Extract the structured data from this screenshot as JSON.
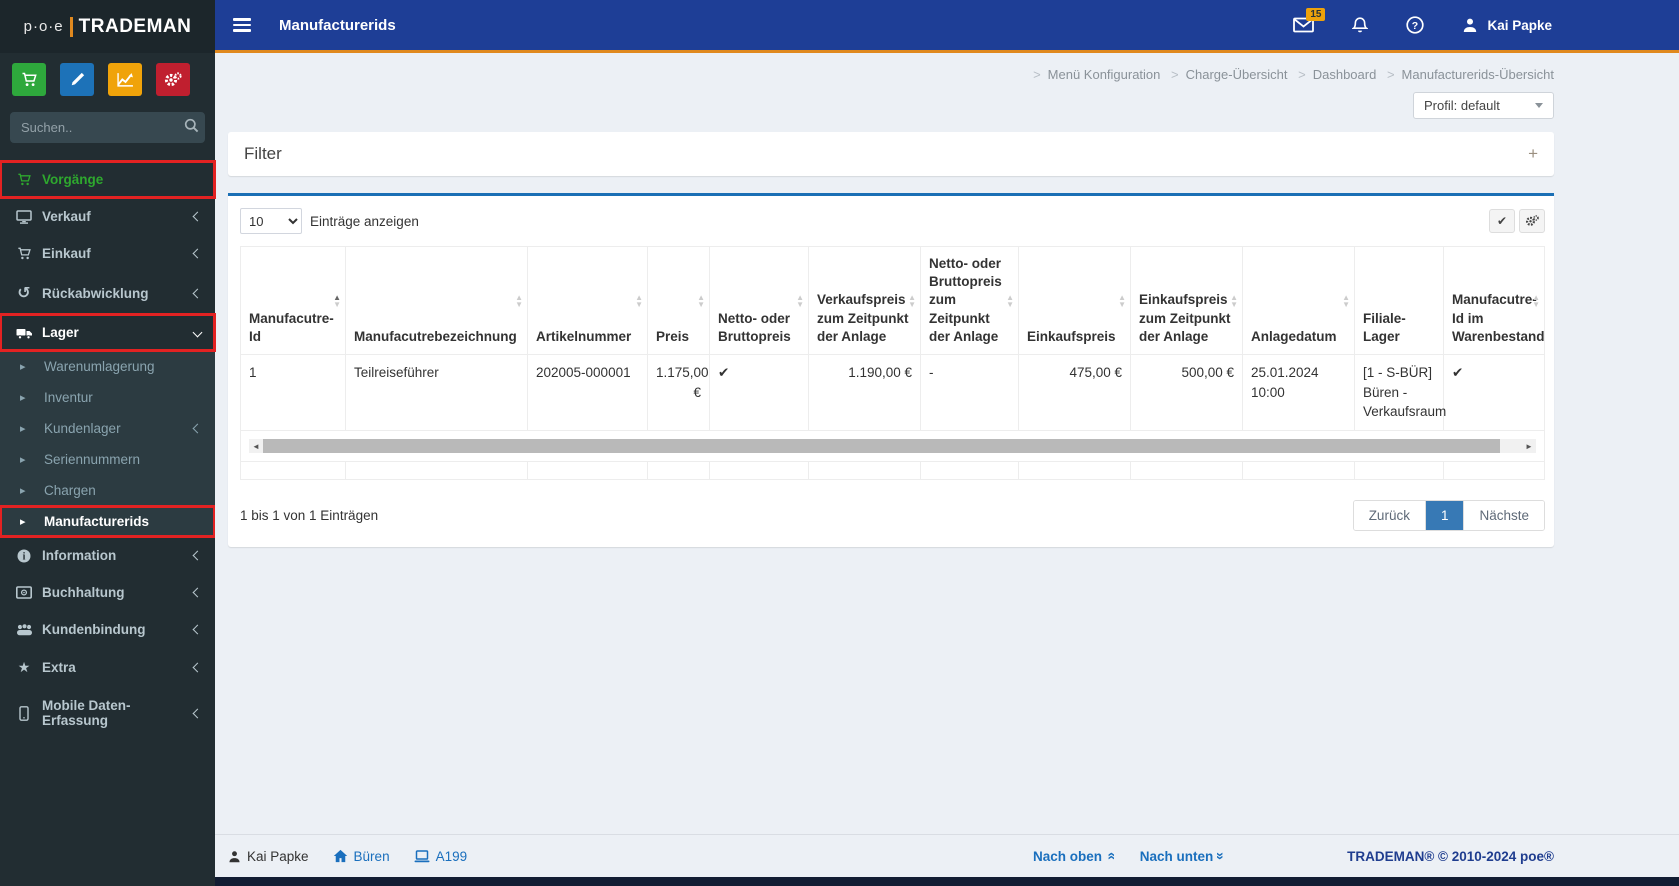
{
  "app": {
    "brand_prefix": "p·o·e",
    "brand": "TRADEMAN"
  },
  "header": {
    "title": "Manufacturerids",
    "mail_badge": "15",
    "user": "Kai Papke"
  },
  "sidebar": {
    "search_placeholder": "Suchen..",
    "quick_buttons": [
      {
        "icon": "cart-icon",
        "color": "#2ea83c"
      },
      {
        "icon": "pencil-icon",
        "color": "#1d72b8"
      },
      {
        "icon": "chart-line-icon",
        "color": "#f0a30a"
      },
      {
        "icon": "gears-icon",
        "color": "#c01f2f"
      }
    ],
    "items": [
      {
        "label": "Vorgänge",
        "icon": "cart-icon",
        "highlighted": true
      },
      {
        "label": "Verkauf",
        "icon": "monitor-icon",
        "has_children": true
      },
      {
        "label": "Einkauf",
        "icon": "cart-icon",
        "has_children": true
      },
      {
        "label": "Rückabwicklung",
        "icon": "undo-icon",
        "has_children": true
      },
      {
        "label": "Lager",
        "icon": "truck-icon",
        "expanded": true,
        "highlighted": true
      },
      {
        "label": "Warenumlagerung",
        "sub": true
      },
      {
        "label": "Inventur",
        "sub": true
      },
      {
        "label": "Kundenlager",
        "sub": true,
        "has_children": true
      },
      {
        "label": "Seriennummern",
        "sub": true
      },
      {
        "label": "Chargen",
        "sub": true
      },
      {
        "label": "Manufacturerids",
        "sub": true,
        "active": true,
        "highlighted": true
      },
      {
        "label": "Information",
        "icon": "info-icon",
        "has_children": true
      },
      {
        "label": "Buchhaltung",
        "icon": "money-icon",
        "has_children": true
      },
      {
        "label": "Kundenbindung",
        "icon": "users-icon",
        "has_children": true
      },
      {
        "label": "Extra",
        "icon": "star-icon",
        "has_children": true
      },
      {
        "label": "Mobile Daten-Erfassung",
        "icon": "mobile-icon",
        "has_children": true
      }
    ]
  },
  "breadcrumb": {
    "items": [
      "Menü Konfiguration",
      "Charge-Übersicht",
      "Dashboard",
      "Manufacturerids-Übersicht"
    ]
  },
  "profile_selector": {
    "value": "Profil: default"
  },
  "filter_panel": {
    "title": "Filter",
    "expand_icon": "+"
  },
  "table_panel": {
    "length_select": {
      "value": "10"
    },
    "length_label": "Einträge anzeigen",
    "columns": [
      "Manufacutre-Id",
      "Manufacutrebezeichnung",
      "Artikelnummer",
      "Preis",
      "Netto- oder Bruttopreis",
      "Verkaufspreis zum Zeitpunkt der Anlage",
      "Netto- oder Bruttopreis zum Zeitpunkt der Anlage",
      "Einkaufspreis",
      "Einkaufspreis zum Zeitpunkt der Anlage",
      "Anlagedatum",
      "Filiale-Lager",
      "Manufacutre-Id im Warenbestand"
    ],
    "rows": [
      [
        "1",
        "Teilreiseführer",
        "202005-000001",
        "1.175,00 €",
        "✔",
        "1.190,00 €",
        "-",
        "475,00 €",
        "500,00 €",
        "25.01.2024 10:00",
        "[1 - S-BÜR] Büren - Verkaufsraum",
        "✔"
      ]
    ],
    "info": "1 bis 1 von 1 Einträgen",
    "pagination": {
      "prev": "Zurück",
      "current": "1",
      "next": "Nächste"
    }
  },
  "footer": {
    "user": "Kai Papke",
    "location": "Büren",
    "device": "A199",
    "nach_oben": "Nach oben",
    "nach_unten": "Nach unten",
    "copyright": "TRADEMAN® © 2010-2024 poe®"
  },
  "colors": {
    "header_blue": "#1e3e96",
    "accent_orange": "#e0891f",
    "highlight_red": "#e32222",
    "sidebar_dark": "#222d32",
    "submenu_dark": "#2c3b41",
    "link_blue": "#1a6fbd",
    "active_page_blue": "#3779b5",
    "vorgaenge_green": "#2ea82e",
    "panel_border_blue": "#1a6fb5",
    "badge_orange": "#eda20c"
  }
}
